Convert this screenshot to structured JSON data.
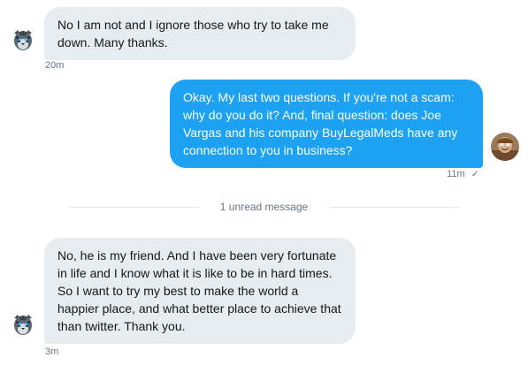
{
  "messages": [
    {
      "direction": "incoming",
      "text": "No I am not and I ignore those who try to take me down. Many thanks.",
      "timestamp": "20m"
    },
    {
      "direction": "outgoing",
      "text": "Okay. My last two questions. If you're not a scam: why do you do it? And, final question: does Joe Vargas and his company BuyLegalMeds have any connection to you in business?",
      "timestamp": "11m",
      "status_icon": "check-icon"
    },
    {
      "direction": "incoming",
      "text": "No, he is my friend. And I have been very fortunate in life and I know what it is like to be in hard times. So I want to try my best to make the world a happier place, and what better place to achieve that than twitter. Thank you.",
      "timestamp": "3m"
    }
  ],
  "divider": {
    "label": "1 unread message"
  },
  "colors": {
    "outgoing_bubble": "#1da1f2",
    "incoming_bubble": "#e6ecf0",
    "meta_text": "#657786"
  },
  "icons": {
    "incoming_avatar": "tiger-avatar-icon",
    "outgoing_avatar": "user-avatar-icon",
    "read_status": "check-icon"
  }
}
